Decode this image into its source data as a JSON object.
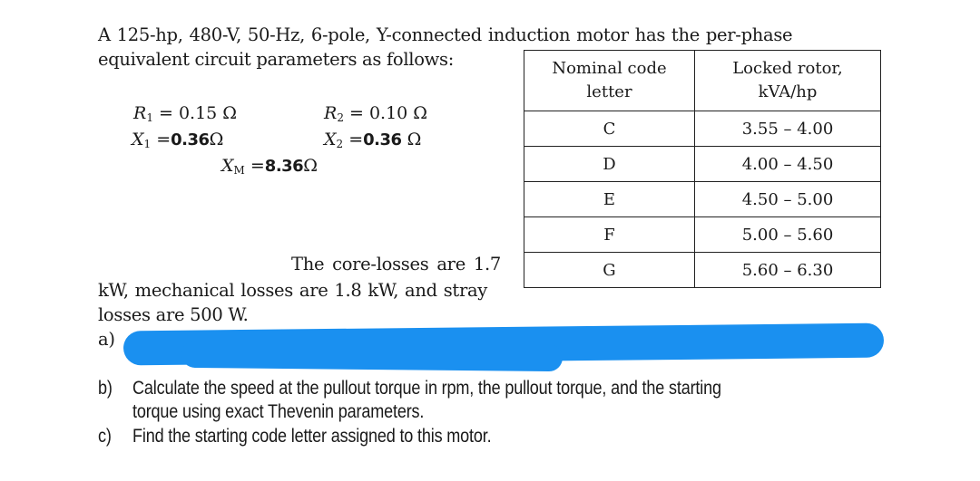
{
  "intro": {
    "line1": "A  125-hp,  480-V,  50-Hz,  6-pole,  Y-connected  induction  motor  has  the  per-phase",
    "line2": "equivalent circuit parameters as follows:"
  },
  "parameters": {
    "R1": {
      "symbol": "R",
      "sub": "1",
      "eq": " = 0.15 Ω"
    },
    "R2": {
      "symbol": "R",
      "sub": "2",
      "eq": " = 0.10 Ω"
    },
    "X1": {
      "symbol": "X",
      "sub": "1",
      "eq": " =",
      "handwritten": "0.36",
      "unit": "Ω"
    },
    "X2": {
      "symbol": "X",
      "sub": "2",
      "eq": " =",
      "handwritten": "0.36",
      "unit": " Ω"
    },
    "XM": {
      "symbol": "X",
      "sub": "M",
      "eq": " =",
      "handwritten": "8.36",
      "unit": "Ω"
    }
  },
  "losses": {
    "line1": "The core-losses are 1.7",
    "line2": "kW, mechanical losses are 1.8 kW, and stray",
    "line3": "losses are 500 W."
  },
  "code_table": {
    "headers": [
      "Nominal code letter",
      "Locked rotor, kVA/hp"
    ],
    "header_lines": [
      [
        "Nominal code",
        "letter"
      ],
      [
        "Locked rotor,",
        "kVA/hp"
      ]
    ],
    "rows": [
      {
        "letter": "C",
        "range": "3.55 – 4.00"
      },
      {
        "letter": "D",
        "range": "4.00 – 4.50"
      },
      {
        "letter": "E",
        "range": "4.50 – 5.00"
      },
      {
        "letter": "F",
        "range": "5.00 – 5.60"
      },
      {
        "letter": "G",
        "range": "5.60 – 6.30"
      }
    ]
  },
  "questions": {
    "a": {
      "label": "a)",
      "redacted": true,
      "redaction_color": "#1a90f0"
    },
    "b": {
      "label": "b)",
      "line1": "Calculate the speed at the pullout torque in rpm, the pullout torque, and the starting",
      "line2": "torque using exact Thevenin parameters."
    },
    "c": {
      "label": "c)",
      "line1": "Find the starting code letter assigned to this motor."
    }
  }
}
